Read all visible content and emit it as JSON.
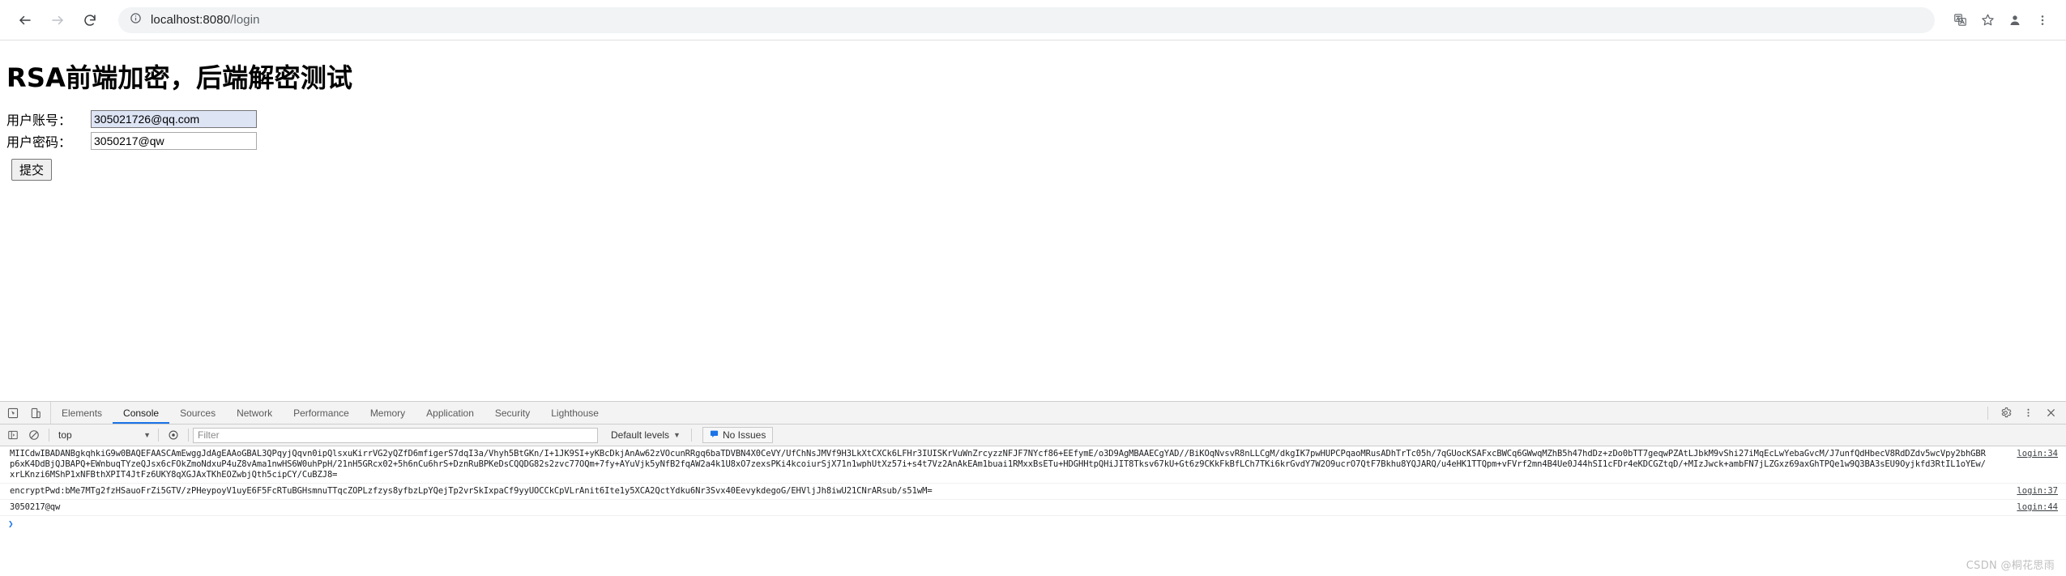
{
  "browser": {
    "back_icon": "arrow-left-icon",
    "forward_icon": "arrow-right-icon",
    "reload_icon": "reload-icon",
    "security_icon": "info-circle-icon",
    "url_host": "localhost:8080",
    "url_path": "/login",
    "url_full": "localhost:8080/login",
    "translate_icon": "translate-icon",
    "bookmark_icon": "star-icon",
    "profile_icon": "account-icon",
    "menu_icon": "kebab-menu-icon"
  },
  "page": {
    "title": "RSA前端加密，后端解密测试",
    "fields": [
      {
        "label": "用户账号：",
        "value": "305021726@qq.com",
        "name": "account"
      },
      {
        "label": "用户密码：",
        "value": "3050217@qw",
        "name": "password"
      }
    ],
    "submit_label": "提交"
  },
  "devtools": {
    "inspect_icon": "inspect-element-icon",
    "device_icon": "device-toolbar-icon",
    "tabs": [
      {
        "label": "Elements",
        "active": false
      },
      {
        "label": "Console",
        "active": true
      },
      {
        "label": "Sources",
        "active": false
      },
      {
        "label": "Network",
        "active": false
      },
      {
        "label": "Performance",
        "active": false
      },
      {
        "label": "Memory",
        "active": false
      },
      {
        "label": "Application",
        "active": false
      },
      {
        "label": "Security",
        "active": false
      },
      {
        "label": "Lighthouse",
        "active": false
      }
    ],
    "settings_icon": "gear-icon",
    "more_icon": "kebab-menu-icon",
    "close_icon": "close-icon",
    "filterbar": {
      "sidebar_icon": "console-sidebar-icon",
      "clear_icon": "clear-console-icon",
      "context": "top",
      "context_caret": "▼",
      "eye_icon": "live-expression-icon",
      "filter_placeholder": "Filter",
      "filter_value": "",
      "levels_label": "Default levels",
      "levels_caret": "▼",
      "issues_icon": "issues-icon",
      "issues_label": "No Issues",
      "issues_icon_color": "#1a73e8"
    },
    "console": {
      "messages": [
        {
          "text": "MIICdwIBADANBgkqhkiG9w0BAQEFAASCAmEwggJdAgEAAoGBAL3QPqyjQqvn0ipQlsxuKirrVG2yQZfD6mfigerS7dqI3a/Vhyh5BtGKn/I+1JK9SI+yKBcDkjAnAw62zVOcunRRgq6baTDVBN4X0CeVY/UfChNsJMVf9H3LkXtCXCk6LFHr3IUISKrVuWnZrcyzzNFJF7NYcf86+EEfymE/o3D9AgMBAAECgYAD//BiKOqNvsvR8nLLCgM/dkgIK7pwHUPCPqaoMRusADhTrTc05h/7qGUocKSAFxcBWCq6GWwqMZhB5h47hdDz+zDo0bTT7geqwPZAtLJbkM9vShi27iMqEcLwYebaGvcM/J7unfQdHbecV8RdDZdv5wcVpy2bhGBRp6xK4DdBjQJBAPQ+EWnbuqTYzeQJsx6cFOkZmoNdxuP4uZ8vAma1nwHS6W0uhPpH/21nH5GRcx02+5h6nCu6hrS+DznRuBPKeDsCQQDG82s2zvc77OQm+7fy+AYuVjk5yNfB2fqAW2a4k1U8xO7zexsPKi4kcoiurSjX71n1wphUtXz57i+s4t7Vz2AnAkEAm1buai1RMxxBsETu+HDGHHtpQHiJIT8Tksv67kU+Gt6z9CKkFkBfLCh7TKi6krGvdY7W2O9ucrO7QtF7Bkhu8YQJARQ/u4eHK1TTQpm+vFVrf2mn4B4Ue0J44hSI1cFDr4eKDCGZtqD/+MIzJwck+ambFN7jLZGxz69axGhTPQe1w9Q3BA3sEU9Oyjkfd3RtIL1oYEw/xrLKnzi6MShP1xNFBthXPIT4JtFz6UKY8qXGJAxTKhEOZwbjQth5cipCY/CuBZJ8=",
          "link": "login:34"
        },
        {
          "text": "encryptPwd:bMe7MTg2fzHSauoFrZi5GTV/zPHeypoyV1uyE6F5FcRTuBGHsmnuTTqcZOPLzfzys8yfbzLpYQejTp2vrSkIxpaCf9yyUOCCkCpVLrAnit6Ite1y5XCA2QctYdku6Nr3Svx40EevykdegoG/EHVljJh8iwU21CNrARsub/s51wM=",
          "link": "login:37"
        },
        {
          "text": "3050217@qw",
          "link": "login:44"
        }
      ],
      "prompt_caret": "❯"
    }
  },
  "watermark": "CSDN @桐花思雨"
}
